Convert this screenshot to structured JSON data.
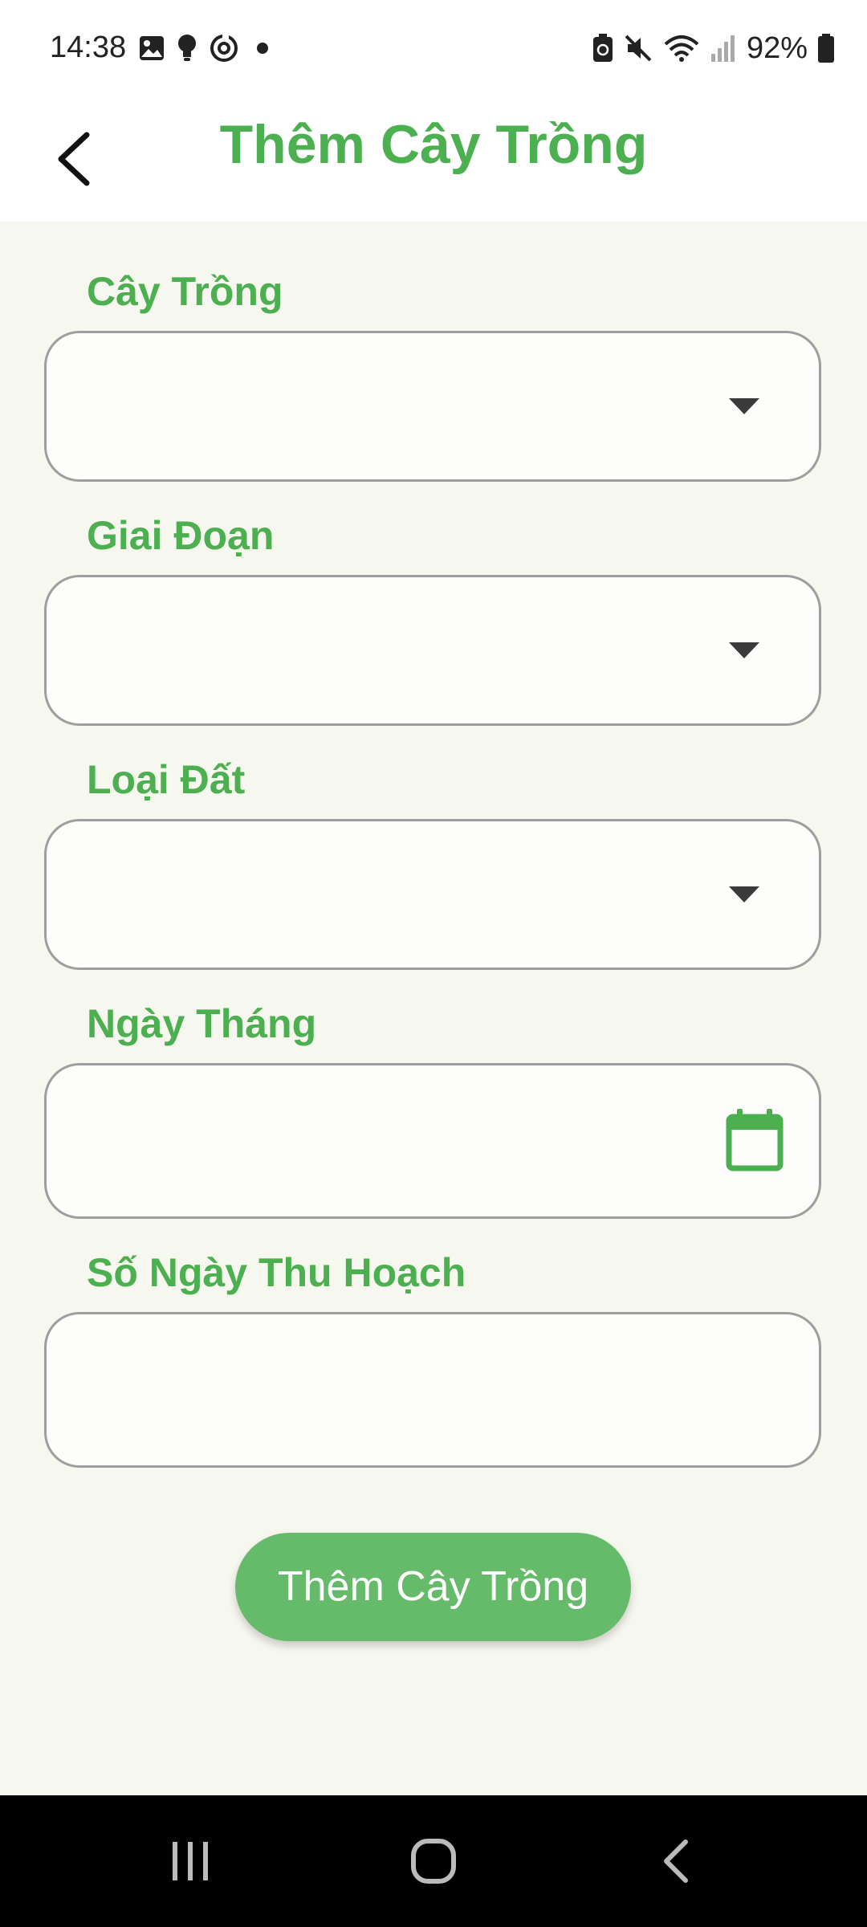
{
  "status_bar": {
    "time": "14:38",
    "battery": "92%"
  },
  "header": {
    "title": "Thêm Cây Trồng"
  },
  "form": {
    "fields": [
      {
        "label": "Cây Trồng",
        "value": ""
      },
      {
        "label": "Giai Đoạn",
        "value": ""
      },
      {
        "label": "Loại Đất",
        "value": ""
      },
      {
        "label": "Ngày Tháng",
        "value": ""
      },
      {
        "label": "Số Ngày Thu Hoạch",
        "value": ""
      }
    ],
    "submit_label": "Thêm Cây Trồng"
  },
  "colors": {
    "accent": "#4caf50",
    "button": "#66bb6a",
    "background": "#f6f7ef"
  },
  "icons": {
    "back": "chevron-left-icon",
    "dropdown": "dropdown-arrow-icon",
    "calendar": "calendar-icon"
  }
}
